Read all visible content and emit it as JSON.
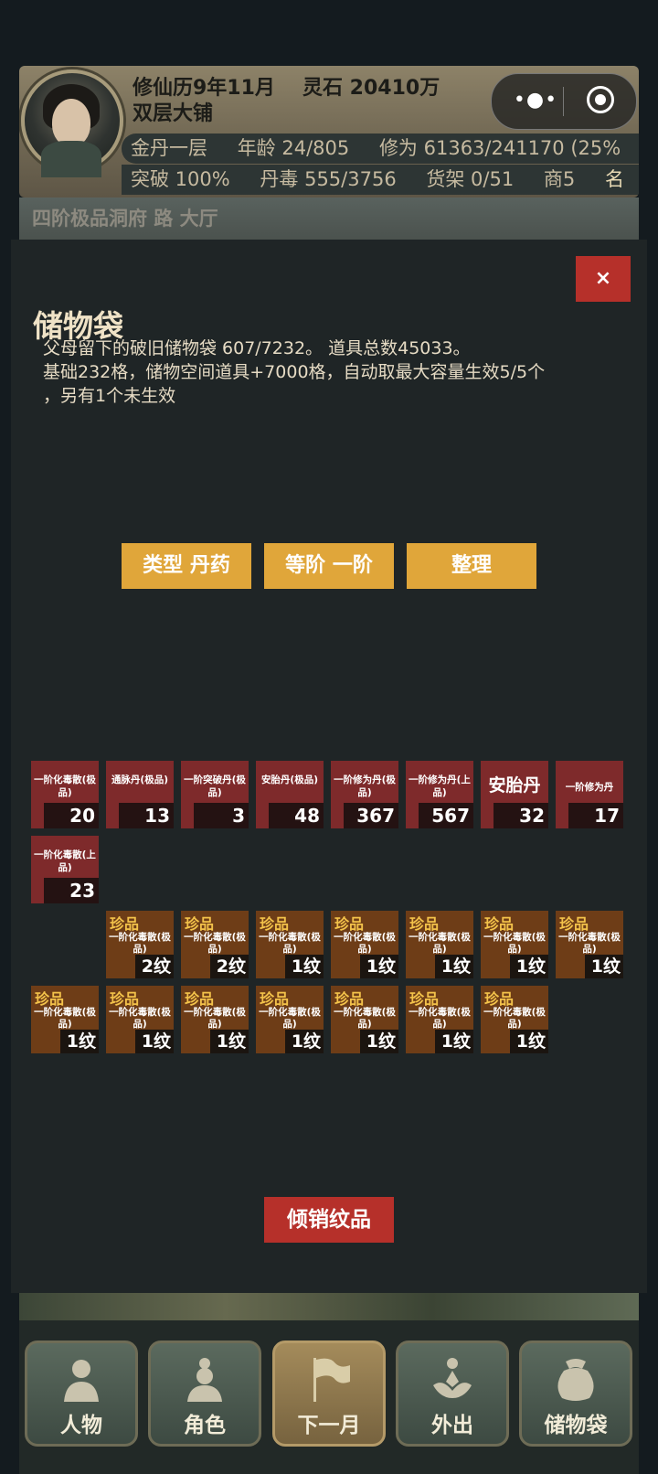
{
  "header": {
    "calendar": "修仙历9年11月",
    "spirit_stone": "灵石 20410万",
    "shop": "双层大铺",
    "stats_row1": [
      "金丹一层",
      "年龄 24/805",
      "修为 61363/241170 (25%"
    ],
    "stats_row2": [
      "突破 100%",
      "丹毒 555/3756",
      "货架 0/51",
      "商5",
      "名"
    ]
  },
  "capsule": {
    "more": "•●•"
  },
  "scene": {
    "top_label": "四阶极品洞府 路 大厅"
  },
  "modal": {
    "close_label": "×",
    "title": "储物袋",
    "desc_line1": "父母留下的破旧储物袋    607/7232。    道具总数45033。",
    "desc_line2": "基础232格，储物空间道具+7000格，自动取最大容量生效5/5个",
    "desc_line3": "，另有1个未生效",
    "filters": {
      "type": "类型 丹药",
      "grade": "等阶 一阶",
      "sort": "整理"
    },
    "items": [
      {
        "name": "一阶化毒散(极品)",
        "count": "20"
      },
      {
        "name": "通脉丹(极品)",
        "count": "13"
      },
      {
        "name": "一阶突破丹(极品)",
        "count": "3"
      },
      {
        "name": "安胎丹(极品)",
        "count": "48"
      },
      {
        "name": "一阶修为丹(极品)",
        "count": "367"
      },
      {
        "name": "一阶修为丹(上品)",
        "count": "567"
      },
      {
        "name": "安胎丹",
        "count": "32"
      },
      {
        "name": "一阶修为丹",
        "count": "17"
      },
      {
        "name": "一阶化毒散(上品)",
        "count": "23"
      }
    ],
    "gems": [
      {
        "tag": "珍品",
        "name": "一阶化毒散(极品)",
        "grain": "2纹"
      },
      {
        "tag": "珍品",
        "name": "一阶化毒散(极品)",
        "grain": "2纹"
      },
      {
        "tag": "珍品",
        "name": "一阶化毒散(极品)",
        "grain": "1纹"
      },
      {
        "tag": "珍品",
        "name": "一阶化毒散(极品)",
        "grain": "1纹"
      },
      {
        "tag": "珍品",
        "name": "一阶化毒散(极品)",
        "grain": "1纹"
      },
      {
        "tag": "珍品",
        "name": "一阶化毒散(极品)",
        "grain": "1纹"
      },
      {
        "tag": "珍品",
        "name": "一阶化毒散(极品)",
        "grain": "1纹"
      },
      {
        "tag": "珍品",
        "name": "一阶化毒散(极品)",
        "grain": "1纹"
      },
      {
        "tag": "珍品",
        "name": "一阶化毒散(极品)",
        "grain": "1纹"
      },
      {
        "tag": "珍品",
        "name": "一阶化毒散(极品)",
        "grain": "1纹"
      },
      {
        "tag": "珍品",
        "name": "一阶化毒散(极品)",
        "grain": "1纹"
      },
      {
        "tag": "珍品",
        "name": "一阶化毒散(极品)",
        "grain": "1纹"
      },
      {
        "tag": "珍品",
        "name": "一阶化毒散(极品)",
        "grain": "1纹"
      },
      {
        "tag": "珍品",
        "name": "一阶化毒散(极品)",
        "grain": "1纹"
      }
    ],
    "dump_label": "倾销纹品"
  },
  "nav": [
    {
      "label": "人物",
      "icon": "person-icon"
    },
    {
      "label": "角色",
      "icon": "role-icon"
    },
    {
      "label": "下一月",
      "icon": "flag-icon"
    },
    {
      "label": "外出",
      "icon": "lotus-icon"
    },
    {
      "label": "储物袋",
      "icon": "bag-icon"
    }
  ]
}
